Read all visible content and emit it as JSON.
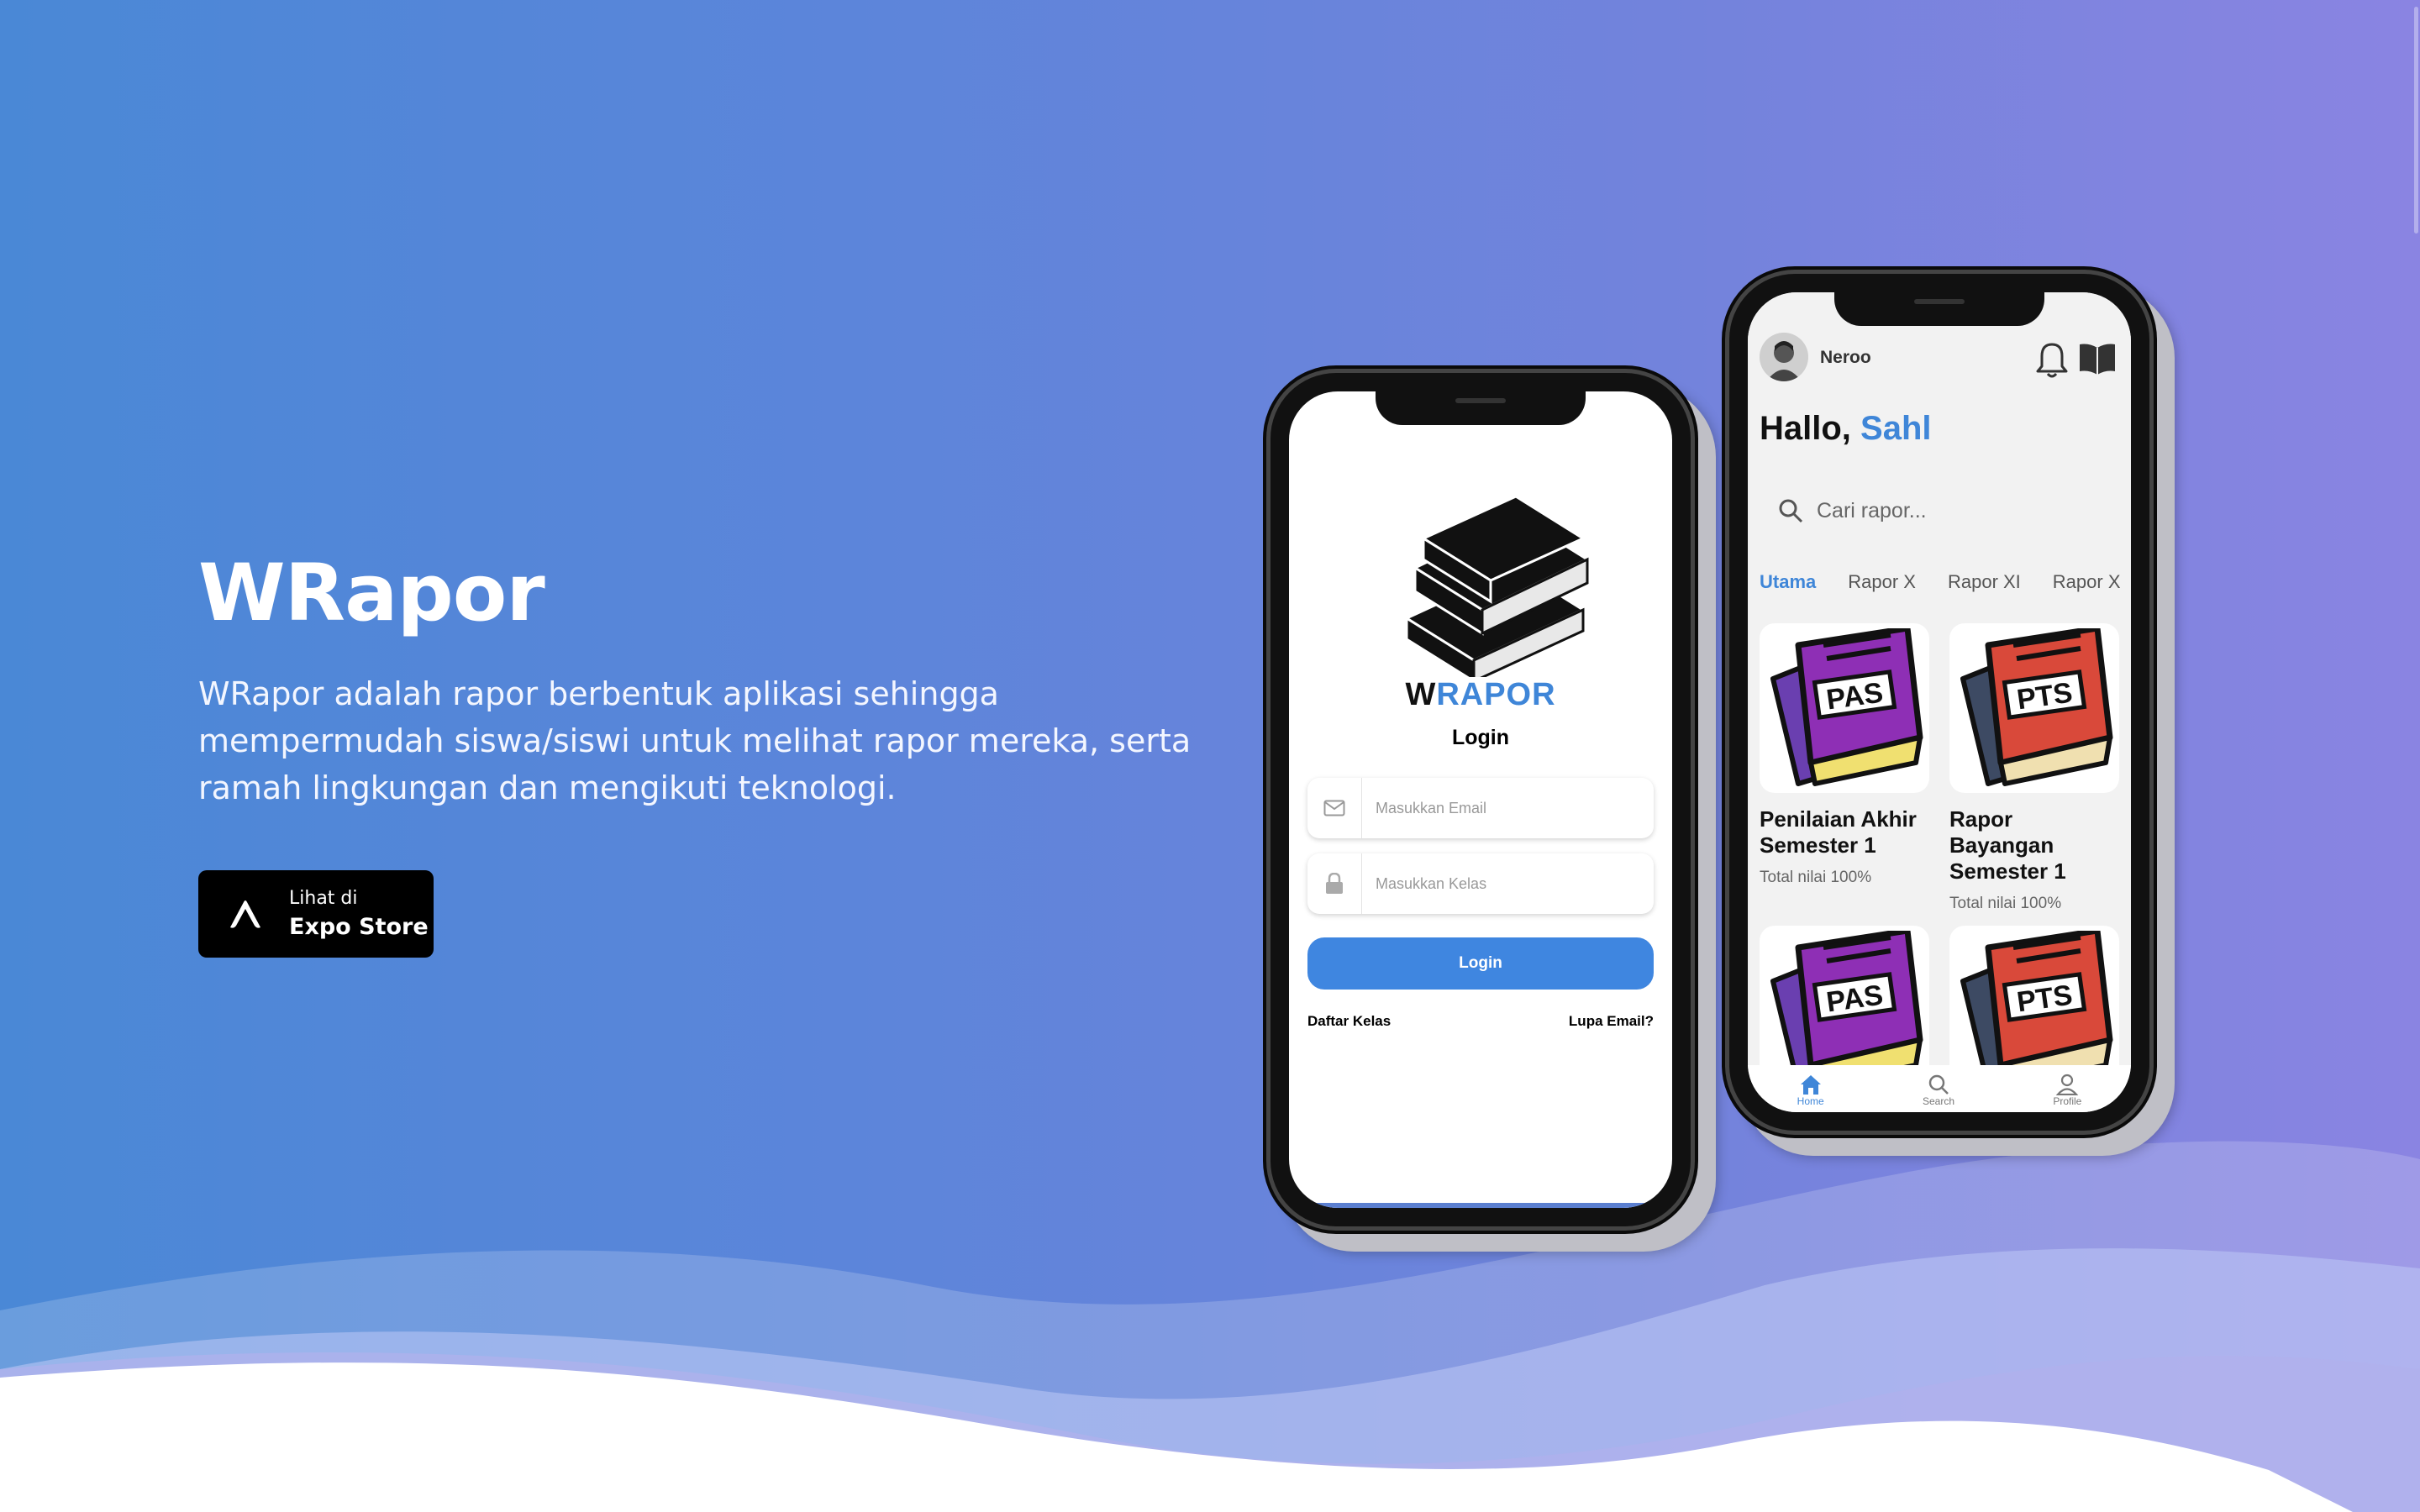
{
  "hero": {
    "title": "WRapor",
    "description": "WRapor adalah rapor berbentuk aplikasi sehingga mempermudah siswa/siswi untuk melihat rapor mereka, serta ramah lingkungan dan mengikuti teknologi.",
    "cta": {
      "small_label": "Lihat di",
      "big_label": "Expo Store",
      "icon": "expo-logo-icon"
    }
  },
  "login_screen": {
    "brand_w": "W",
    "brand_rest": "RAPOR",
    "title": "Login",
    "email_placeholder": "Masukkan Email",
    "kelas_placeholder": "Masukkan Kelas",
    "login_button": "Login",
    "link_left": "Daftar Kelas",
    "link_right": "Lupa Email?"
  },
  "home_screen": {
    "username": "Neroo",
    "greeting": "Hallo,",
    "greeting_name": "Sahl",
    "search_placeholder": "Cari rapor...",
    "tabs": [
      "Utama",
      "Rapor X",
      "Rapor XI",
      "Rapor XII"
    ],
    "cards": [
      {
        "badge": "PAS",
        "title": "Penilaian Akhir Semester 1",
        "subtitle": "Total nilai 100%"
      },
      {
        "badge": "PTS",
        "title": "Rapor Bayangan Semester 1",
        "subtitle": "Total nilai 100%"
      },
      {
        "badge": "PAS"
      },
      {
        "badge": "PTS"
      }
    ],
    "nav": [
      {
        "label": "Home",
        "icon": "home-icon"
      },
      {
        "label": "Search",
        "icon": "search-icon"
      },
      {
        "label": "Profile",
        "icon": "profile-icon"
      }
    ]
  },
  "colors": {
    "accent": "#3f86d8",
    "bg_left": "#4a88d6",
    "bg_right": "#8a84e2",
    "pas_purple": "#8e2fb5",
    "pts_red": "#d9493a"
  }
}
